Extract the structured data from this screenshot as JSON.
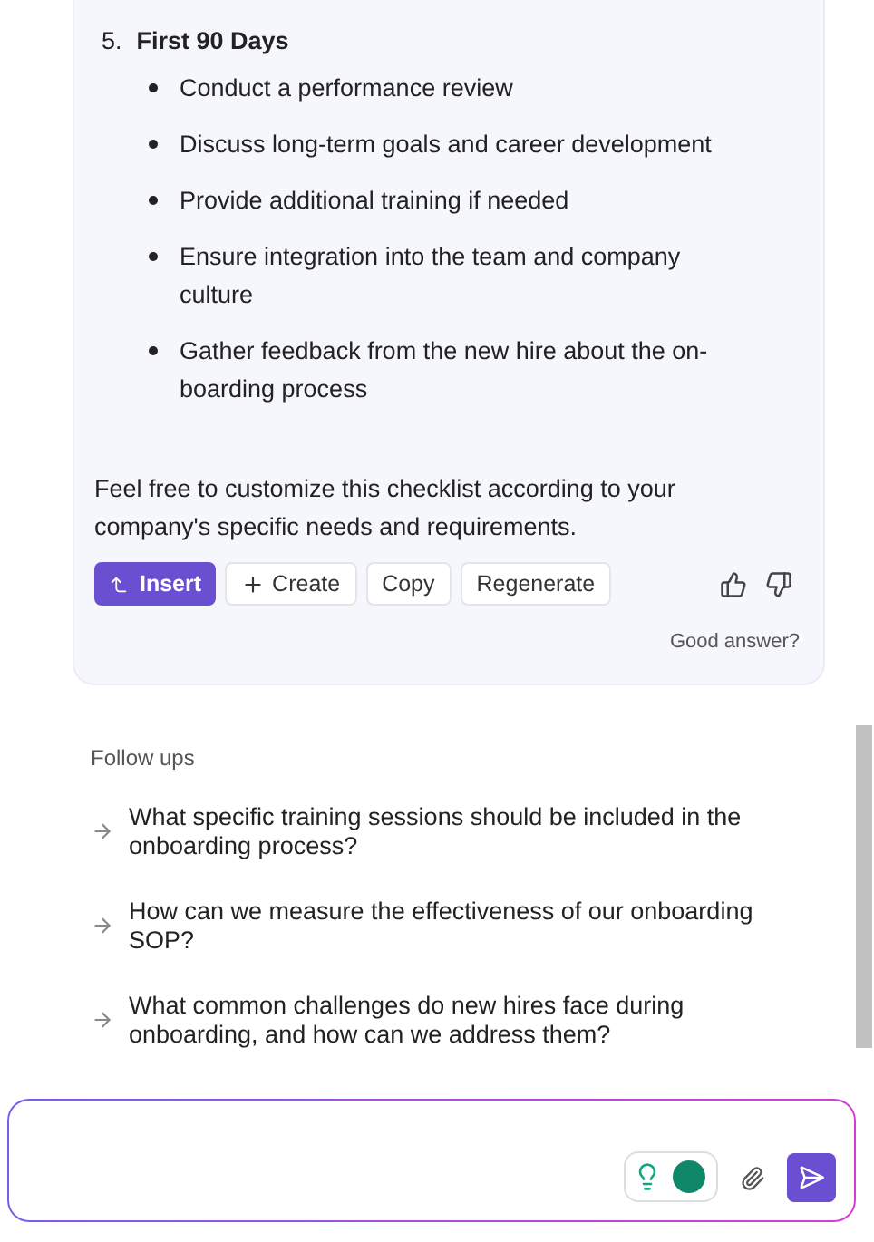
{
  "answer": {
    "section": {
      "number": "5.",
      "title": "First 90 Days",
      "items": [
        "Conduct a performance review",
        "Discuss long-term goals and career development",
        "Provide additional training if needed",
        "Ensure integration into the team and company culture",
        "Gather feedback from the new hire about the on-boarding process"
      ]
    },
    "closing": "Feel free to customize this checklist according to your company's specific needs and requirements.",
    "actions": [
      {
        "label": "Insert",
        "kind": "primary"
      },
      {
        "label": "Create",
        "kind": "create"
      },
      {
        "label": "Copy",
        "kind": "plain"
      },
      {
        "label": "Regenerate",
        "kind": "plain"
      }
    ],
    "feedback": "Good answer?"
  },
  "follow_ups": {
    "title": "Follow ups",
    "items": [
      "What specific training sessions should be included in the onboarding process?",
      "How can we measure the effectiveness of our onboarding SOP?",
      "What common challenges do new hires face during onboarding, and how can we address them?"
    ]
  }
}
